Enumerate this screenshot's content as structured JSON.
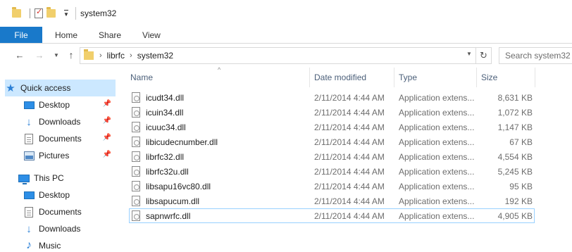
{
  "window": {
    "title": "system32"
  },
  "ribbon": {
    "tabs": [
      "File",
      "Home",
      "Share",
      "View"
    ]
  },
  "address": {
    "breadcrumbs": [
      "librfc",
      "system32"
    ]
  },
  "search": {
    "placeholder": "Search system32"
  },
  "navpane": {
    "quick_access": "Quick access",
    "quick_items": [
      {
        "label": "Desktop",
        "icon": "desktop-icon",
        "pinned": true
      },
      {
        "label": "Downloads",
        "icon": "downloads-icon",
        "pinned": true
      },
      {
        "label": "Documents",
        "icon": "documents-icon",
        "pinned": true
      },
      {
        "label": "Pictures",
        "icon": "pictures-icon",
        "pinned": true
      }
    ],
    "this_pc": "This PC",
    "pc_items": [
      {
        "label": "Desktop",
        "icon": "desktop-icon"
      },
      {
        "label": "Documents",
        "icon": "documents-icon"
      },
      {
        "label": "Downloads",
        "icon": "downloads-icon"
      },
      {
        "label": "Music",
        "icon": "music-icon"
      }
    ]
  },
  "filelist": {
    "columns": {
      "name": "Name",
      "date": "Date modified",
      "type": "Type",
      "size": "Size"
    },
    "files": [
      {
        "name": "icudt34.dll",
        "date": "2/11/2014 4:44 AM",
        "type": "Application extens...",
        "size": "8,631 KB"
      },
      {
        "name": "icuin34.dll",
        "date": "2/11/2014 4:44 AM",
        "type": "Application extens...",
        "size": "1,072 KB"
      },
      {
        "name": "icuuc34.dll",
        "date": "2/11/2014 4:44 AM",
        "type": "Application extens...",
        "size": "1,147 KB"
      },
      {
        "name": "libicudecnumber.dll",
        "date": "2/11/2014 4:44 AM",
        "type": "Application extens...",
        "size": "67 KB"
      },
      {
        "name": "librfc32.dll",
        "date": "2/11/2014 4:44 AM",
        "type": "Application extens...",
        "size": "4,554 KB"
      },
      {
        "name": "librfc32u.dll",
        "date": "2/11/2014 4:44 AM",
        "type": "Application extens...",
        "size": "5,245 KB"
      },
      {
        "name": "libsapu16vc80.dll",
        "date": "2/11/2014 4:44 AM",
        "type": "Application extens...",
        "size": "95 KB"
      },
      {
        "name": "libsapucum.dll",
        "date": "2/11/2014 4:44 AM",
        "type": "Application extens...",
        "size": "192 KB"
      },
      {
        "name": "sapnwrfc.dll",
        "date": "2/11/2014 4:44 AM",
        "type": "Application extens...",
        "size": "4,905 KB"
      }
    ]
  },
  "colors": {
    "file_tab": "#1979ca",
    "selection": "#cce8ff",
    "header_text": "#4c607a"
  }
}
